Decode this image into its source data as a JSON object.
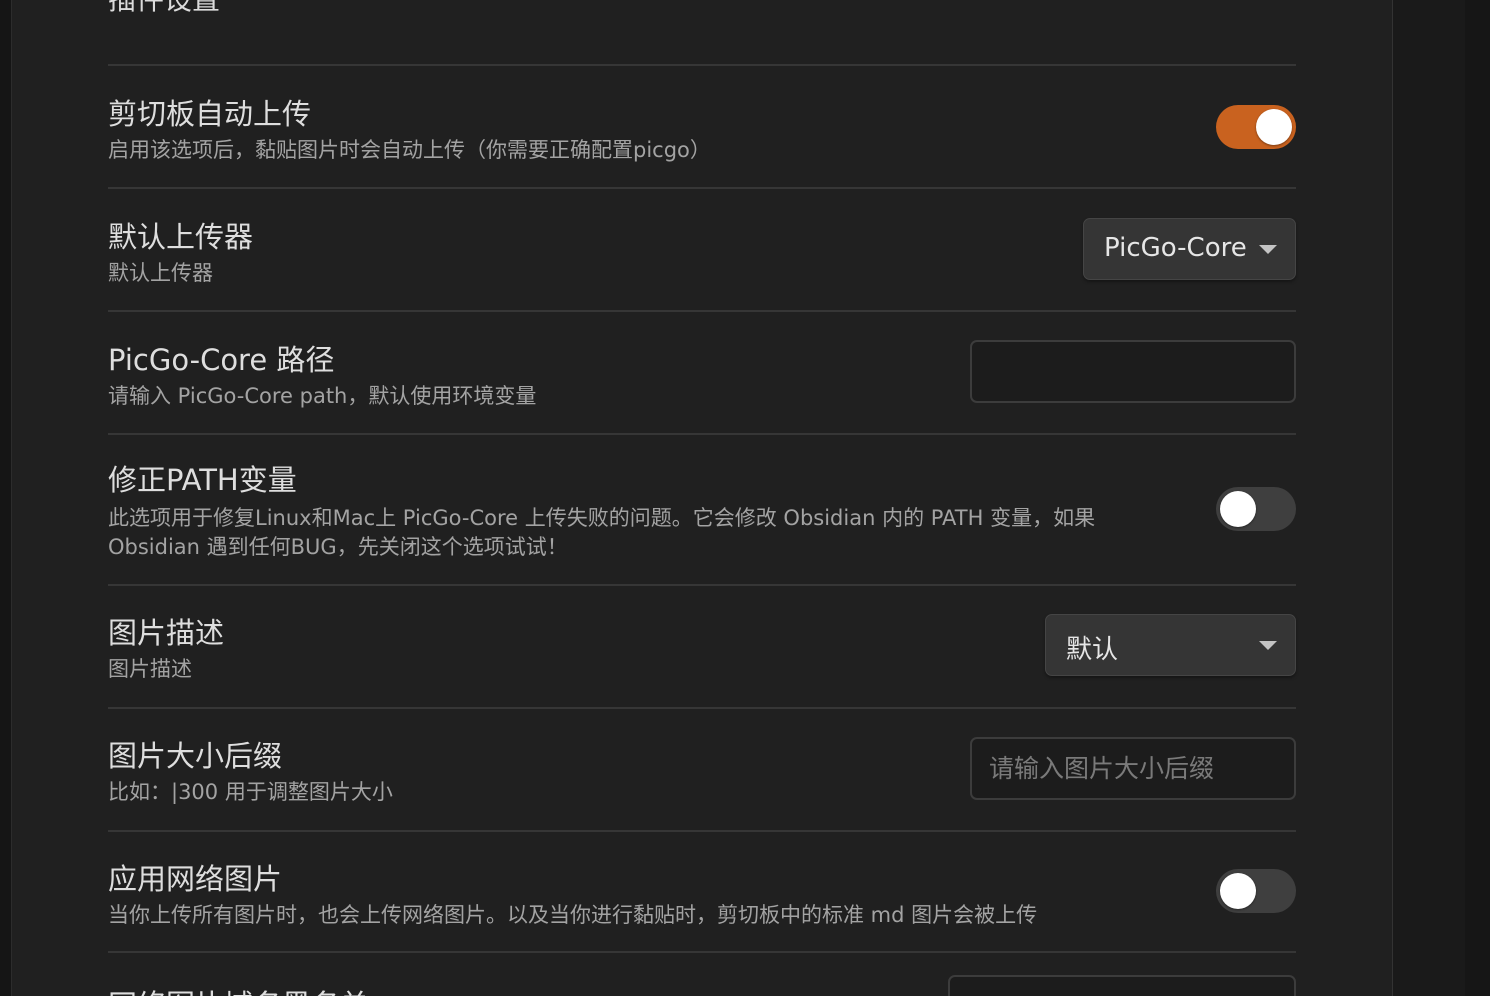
{
  "section": {
    "heading": "插件设置"
  },
  "settings": {
    "clipboard_upload": {
      "name": "剪切板自动上传",
      "desc": "启用该选项后，黏贴图片时会自动上传（你需要正确配置picgo）",
      "enabled": true
    },
    "default_uploader": {
      "name": "默认上传器",
      "desc": "默认上传器",
      "selected": "PicGo-Core"
    },
    "picgo_core_path": {
      "name": "PicGo-Core 路径",
      "desc": "请输入 PicGo-Core path，默认使用环境变量",
      "value": "",
      "placeholder": ""
    },
    "fix_path": {
      "name": "修正PATH变量",
      "desc_line1": "此选项用于修复Linux和Mac上 PicGo-Core 上传失败的问题。它会修改 Obsidian 内的 PATH 变量，如果",
      "desc_line2": "Obsidian 遇到任何BUG，先关闭这个选项试试！",
      "enabled": false
    },
    "image_desc": {
      "name": "图片描述",
      "desc": "图片描述",
      "selected": "默认"
    },
    "image_size_suffix": {
      "name": "图片大小后缀",
      "desc": "比如：|300 用于调整图片大小",
      "value": "",
      "placeholder": "请输入图片大小后缀"
    },
    "network_images": {
      "name": "应用网络图片",
      "desc": "当你上传所有图片时，也会上传网络图片。以及当你进行黏贴时，剪切板中的标准 md 图片会被上传",
      "enabled": false
    },
    "domain_blacklist": {
      "name": "网络图片域名黑名单"
    }
  },
  "colors": {
    "accent": "#c9621f",
    "panel_bg": "#202020",
    "divider": "#363636"
  }
}
